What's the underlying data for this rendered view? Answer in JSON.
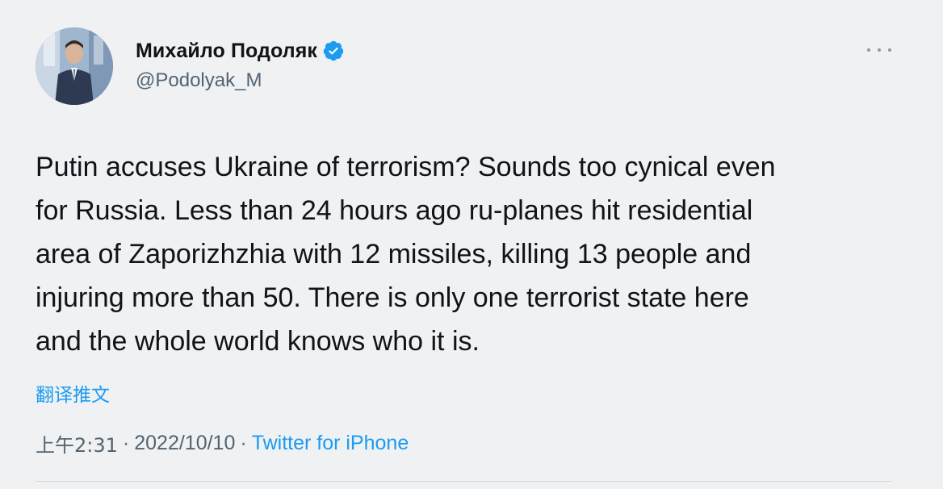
{
  "author": {
    "display_name": "Михайло Подоляк",
    "handle": "@Podolyak_M",
    "verified": true
  },
  "tweet": {
    "text": "Putin accuses Ukraine of terrorism? Sounds too cynical even\nfor Russia. Less than 24 hours ago ru-planes hit residential\narea of Zaporizhzhia with 12 missiles, killing 13 people and\ninjuring more than 50. There is only one terrorist state here\nand the whole world knows who it is.",
    "translate_label": "翻译推文"
  },
  "meta": {
    "time": "上午2:31",
    "separator": "·",
    "date": "2022/10/10",
    "source": "Twitter for iPhone"
  },
  "colors": {
    "background": "#eff1f3",
    "text": "#0f1419",
    "secondary": "#536471",
    "accent": "#1d9bf0"
  },
  "icons": {
    "verified": "verified-badge-icon",
    "more": "more-options-icon"
  }
}
